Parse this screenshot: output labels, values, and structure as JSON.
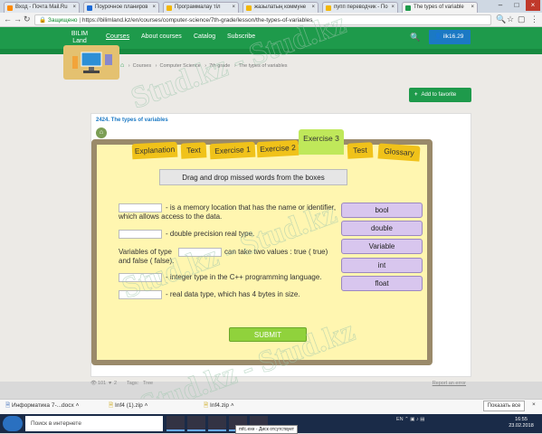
{
  "browser": {
    "tabs": [
      {
        "title": "Вход - Почта Mail.Ru",
        "color": "#ff8a00"
      },
      {
        "title": "Поурочное планиров",
        "color": "#1e6bd6"
      },
      {
        "title": "Программалау тіл",
        "color": "#f2b705"
      },
      {
        "title": "жазылатың коммуне",
        "color": "#f2b705"
      },
      {
        "title": "пупп переводчик - По",
        "color": "#f2b705"
      },
      {
        "title": "The types of variable",
        "color": "#1e9a4b"
      }
    ],
    "secure_label": "Защищено",
    "url": "https://bilimland.kz/en/courses/computer-science/7th-grade/lesson/the-types-of-variables"
  },
  "site": {
    "logo_line1": "BILIM",
    "logo_line2": "Land",
    "nav": [
      "Courses",
      "About courses",
      "Catalog",
      "Subscribe"
    ],
    "user": "ilk16.29",
    "breadcrumb": [
      "Courses",
      "Computer Science",
      "7th grade",
      "The types of variables"
    ],
    "add_favorite": "Add to favorite"
  },
  "lesson": {
    "title": "2424. The types of variables",
    "tabs": [
      "Explanation",
      "Text",
      "Exercise 1",
      "Exercise 2",
      "Exercise 3",
      "Test",
      "Glossary"
    ],
    "instruction": "Drag and drop missed words from the boxes",
    "questions": [
      {
        "after": "- is a memory location that has the name or identifier, which allows access to the data."
      },
      {
        "after": "- double precision real type."
      },
      {
        "before": "Variables of type",
        "after": "can take two values : true ( true) and false ( false)."
      },
      {
        "after": "- integer type in the C++ programming language."
      },
      {
        "after": "- real data type, which has 4 bytes in size."
      }
    ],
    "options": [
      "bool",
      "double",
      "Variable",
      "int",
      "float"
    ],
    "submit": "SUBMIT"
  },
  "card_footer": {
    "views": "101",
    "likes": "2",
    "tags_label": "Tags:",
    "tags": "Tree",
    "report": "Report an error"
  },
  "watermark": "Stud.kz - Stud.kz",
  "downloads": [
    {
      "name": "Информатика 7-...docx"
    },
    {
      "name": "Inf4 (1).zip"
    },
    {
      "name": "Inf4.zip"
    }
  ],
  "show_all": "Показать все",
  "taskbar": {
    "search_placeholder": "Поиск в интернете",
    "tooltip": "mfc.exe - Диск отсутствует",
    "lang": "EN",
    "time": "16:55",
    "date": "23.02.2018"
  }
}
